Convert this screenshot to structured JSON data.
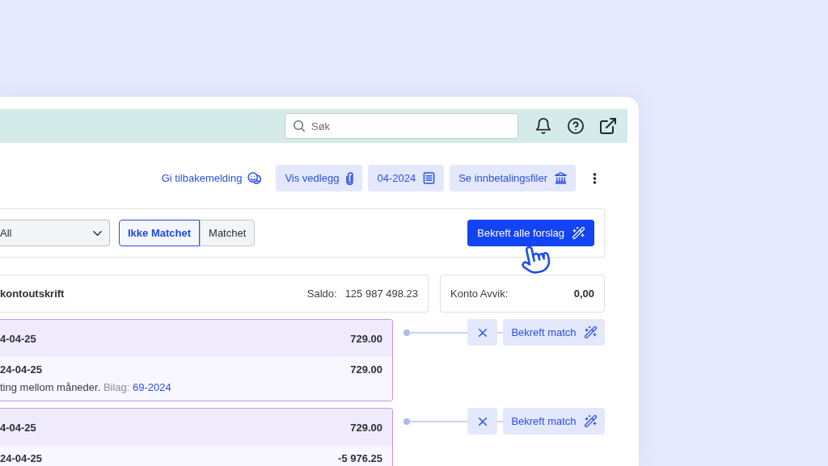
{
  "header": {
    "search": {
      "placeholder": "Søk"
    }
  },
  "toolbar": {
    "feedback_link": "Gi tilbakemelding",
    "buttons": [
      {
        "kind": "attachments",
        "label": "Vis vedlegg"
      },
      {
        "kind": "period",
        "label": "04-2024"
      },
      {
        "kind": "payment_files",
        "label": "Se innbetalingsfiler"
      }
    ]
  },
  "filter": {
    "select": {
      "value": "All"
    },
    "segments": [
      {
        "label": "Ikke Matchet",
        "selected": true
      },
      {
        "label": "Matchet",
        "selected": false
      }
    ],
    "confirm_all_button": "Bekreft alle forslag"
  },
  "summary": {
    "statement": {
      "title": "kontoutskrift",
      "balance_label": "Saldo:",
      "balance": "125 987 498.23"
    },
    "deviation": {
      "label": "Konto Avvik:",
      "value": "0,00"
    }
  },
  "matches": [
    {
      "bank_line": {
        "date": "4-04-25",
        "amount": "729.00"
      },
      "ledger_line": {
        "date": "24-04-25",
        "amount": "729.00",
        "description": "ting mellom måneder.",
        "voucher_label": "Bilag:",
        "voucher": "69-2024"
      },
      "confirm_button": "Bekreft match"
    },
    {
      "bank_line": {
        "date": "4-04-25",
        "amount": "729.00"
      },
      "ledger_line": {
        "date": "24-04-25",
        "amount": "-5 976.25"
      },
      "confirm_button": "Bekreft match"
    }
  ]
}
